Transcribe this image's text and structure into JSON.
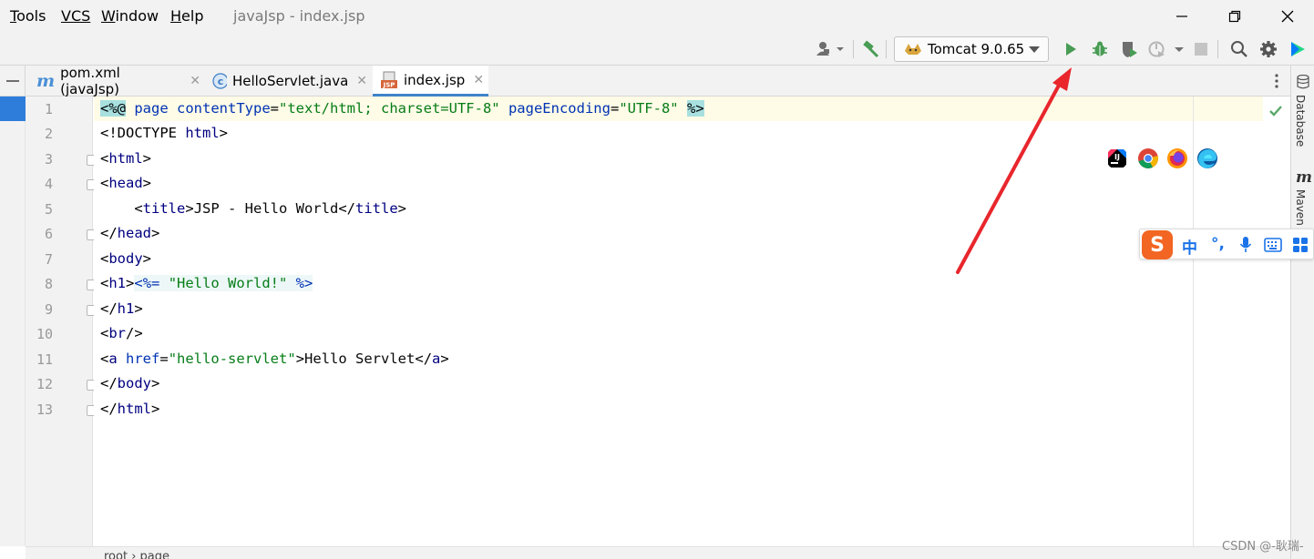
{
  "menu": {
    "items": [
      {
        "first": "T",
        "rest": "ools"
      },
      {
        "first": "",
        "rest": "VCS"
      },
      {
        "first": "W",
        "rest": "indow"
      },
      {
        "first": "H",
        "rest": "elp"
      }
    ],
    "window_title": "javaJsp - index.jsp"
  },
  "toolbar": {
    "run_config": "Tomcat 9.0.65"
  },
  "tabs": [
    {
      "label": "pom.xml (javaJsp)",
      "icon": "maven-icon",
      "active": false
    },
    {
      "label": "HelloServlet.java",
      "icon": "java-class-icon",
      "active": false
    },
    {
      "label": "index.jsp",
      "icon": "jsp-file-icon",
      "active": true
    }
  ],
  "right_stripe": {
    "database": "Database",
    "maven": "Maven"
  },
  "editor": {
    "line_numbers": [
      "1",
      "2",
      "3",
      "4",
      "5",
      "6",
      "7",
      "8",
      "9",
      "10",
      "11",
      "12",
      "13"
    ]
  },
  "code": {
    "l1": {
      "open": "<%@",
      "kw": " page ",
      "a1": "contentType",
      "eq1": "=",
      "v1": "\"text/html; charset=UTF-8\"",
      "a2": " pageEncoding",
      "eq2": "=",
      "v2": "\"UTF-8\"",
      "close": "%>"
    },
    "l2": {
      "a": "<!DOCTYPE ",
      "b": "html",
      "c": ">"
    },
    "l3": {
      "a": "<",
      "b": "html",
      "c": ">"
    },
    "l4": {
      "a": "<",
      "b": "head",
      "c": ">"
    },
    "l5": {
      "indent": "    ",
      "a": "<",
      "b": "title",
      "c": ">",
      "text": "JSP - Hello World",
      "d": "</",
      "e": "title",
      "f": ">"
    },
    "l6": {
      "a": "</",
      "b": "head",
      "c": ">"
    },
    "l7": {
      "a": "<",
      "b": "body",
      "c": ">"
    },
    "l8": {
      "a": "<",
      "b": "h1",
      "c": ">",
      "d": "<%= ",
      "e": "\"Hello World!\"",
      "f": " %>"
    },
    "l9": {
      "a": "</",
      "b": "h1",
      "c": ">"
    },
    "l10": {
      "a": "<",
      "b": "br",
      "c": "/>"
    },
    "l11": {
      "a": "<",
      "b": "a",
      "c": " href",
      "d": "=",
      "e": "\"hello-servlet\"",
      "f": ">",
      "text": "Hello Servlet",
      "g": "</",
      "h": "a",
      "i": ">"
    },
    "l12": {
      "a": "</",
      "b": "body",
      "c": ">"
    },
    "l13": {
      "a": "</",
      "b": "html",
      "c": ">"
    }
  },
  "ime": {
    "lang": "中",
    "punct": "°,"
  },
  "breadcrumb": "root  ›  page",
  "watermark": "CSDN @-耿瑞-",
  "colors": {
    "accent": "#4083c9",
    "run_green": "#499c54",
    "arrow_red": "#e8262c"
  }
}
